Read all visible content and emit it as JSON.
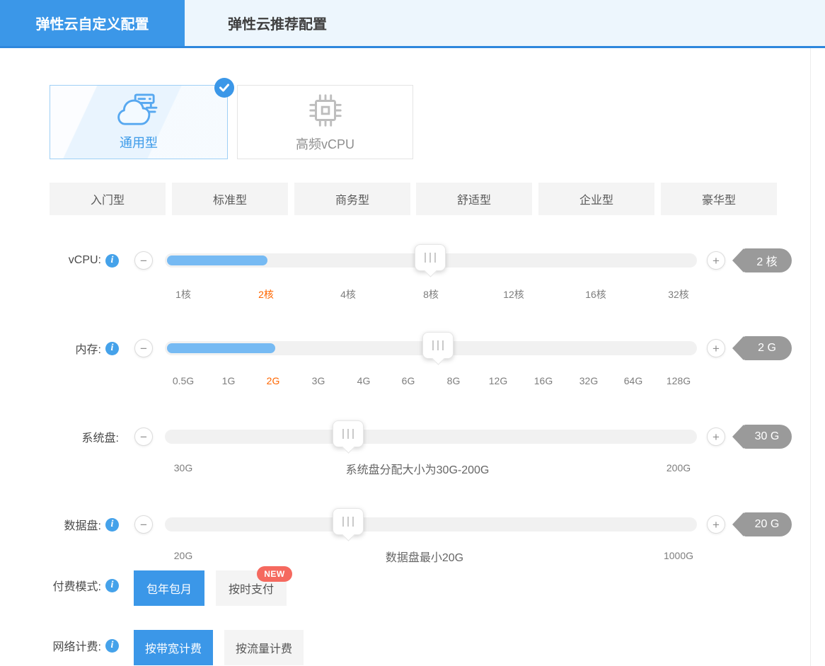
{
  "colors": {
    "accent_blue": "#3b97e8",
    "tab_border_blue": "#2e87dd",
    "slider_fill_blue": "#76baf3",
    "tick_highlight_orange": "#ff6600",
    "value_badge_gray": "#9a9a9a",
    "new_badge_red": "#f5695f"
  },
  "tabs": [
    {
      "label": "弹性云自定义配置",
      "active": true
    },
    {
      "label": "弹性云推荐配置",
      "active": false
    }
  ],
  "instance_types": [
    {
      "label": "通用型",
      "selected": true,
      "icon": "cloud-server-icon"
    },
    {
      "label": "高频vCPU",
      "selected": false,
      "icon": "cpu-chip-icon"
    }
  ],
  "spec_presets": [
    "入门型",
    "标准型",
    "商务型",
    "舒适型",
    "企业型",
    "豪华型"
  ],
  "sliders": {
    "vcpu": {
      "label": "vCPU:",
      "value_badge": "2 核",
      "selected_tick": "2核",
      "ticks": [
        "1核",
        "2核",
        "4核",
        "8核",
        "12核",
        "16核",
        "32核"
      ]
    },
    "memory": {
      "label": "内存:",
      "value_badge": "2 G",
      "selected_tick": "2G",
      "ticks": [
        "0.5G",
        "1G",
        "2G",
        "3G",
        "4G",
        "6G",
        "8G",
        "12G",
        "16G",
        "32G",
        "64G",
        "128G"
      ]
    },
    "system_disk": {
      "label": "系统盘:",
      "value_badge": "30 G",
      "min_label": "30G",
      "hint": "系统盘分配大小为30G-200G",
      "max_label": "200G"
    },
    "data_disk": {
      "label": "数据盘:",
      "value_badge": "20 G",
      "min_label": "20G",
      "hint": "数据盘最小20G",
      "max_label": "1000G"
    }
  },
  "payment_mode": {
    "label": "付费模式:",
    "options": [
      {
        "label": "包年包月",
        "selected": true
      },
      {
        "label": "按时支付",
        "selected": false,
        "badge": "NEW"
      }
    ]
  },
  "network_billing": {
    "label": "网络计费:",
    "options": [
      {
        "label": "按带宽计费",
        "selected": true
      },
      {
        "label": "按流量计费",
        "selected": false
      }
    ]
  }
}
